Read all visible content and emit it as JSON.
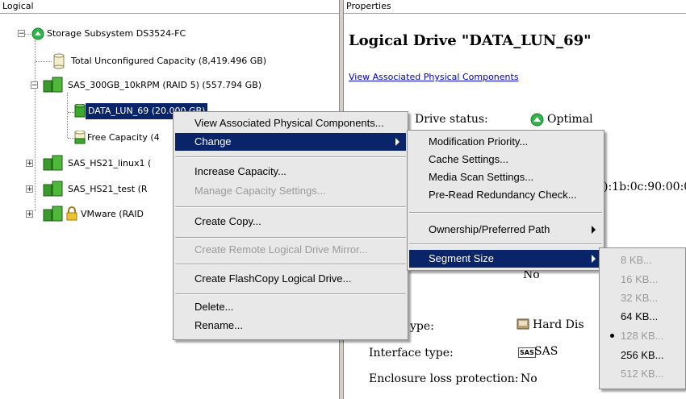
{
  "left_pane": {
    "header": "Logical",
    "tree": {
      "root": "Storage Subsystem DS3524-FC",
      "unconfigured": "Total Unconfigured Capacity (8,419.496 GB)",
      "array1": "SAS_300GB_10kRPM (RAID 5) (557.794 GB)",
      "lun": "DATA_LUN_69 (20.000 GB)",
      "free": "Free Capacity (4",
      "array2": "SAS_HS21_linux1 (",
      "array3": "SAS_HS21_test (R",
      "array4": "VMware (RAID"
    }
  },
  "right_pane": {
    "header": "Properties",
    "title": "Logical Drive \"DATA_LUN_69\"",
    "link": "View Associated Physical Components",
    "drive_status_label": "Drive status:",
    "drive_status_value": "Optimal",
    "wwid_fragment": "):1b:0c:90:00:0",
    "no_value": "No",
    "type_label_fragment": "ype:",
    "type_value": "Hard Dis",
    "interface_label": "Interface type:",
    "interface_badge": "SAS",
    "interface_value": "SAS",
    "enclosure_label": "Enclosure loss protection:",
    "enclosure_value": "No"
  },
  "context_menu": {
    "items": [
      {
        "label": "View Associated Physical Components...",
        "disabled": false
      },
      {
        "label": "Change",
        "disabled": false,
        "submenu": true
      },
      {
        "label": "Increase Capacity...",
        "disabled": false
      },
      {
        "label": "Manage Capacity Settings...",
        "disabled": true
      },
      {
        "label": "Create Copy...",
        "disabled": false
      },
      {
        "label": "Create Remote Logical Drive Mirror...",
        "disabled": true
      },
      {
        "label": "Create FlashCopy Logical Drive...",
        "disabled": false
      },
      {
        "label": "Delete...",
        "disabled": false
      },
      {
        "label": "Rename...",
        "disabled": false
      }
    ]
  },
  "change_submenu": {
    "items": [
      {
        "label": "Modification Priority..."
      },
      {
        "label": "Cache Settings..."
      },
      {
        "label": "Media Scan Settings..."
      },
      {
        "label": "Pre-Read Redundancy Check..."
      },
      {
        "label": "Ownership/Preferred Path",
        "submenu": true
      },
      {
        "label": "Segment Size",
        "submenu": true
      }
    ]
  },
  "segment_submenu": {
    "items": [
      {
        "label": "8 KB...",
        "disabled": true
      },
      {
        "label": "16 KB...",
        "disabled": true
      },
      {
        "label": "32 KB...",
        "disabled": true
      },
      {
        "label": "64 KB...",
        "disabled": false
      },
      {
        "label": "128 KB...",
        "disabled": true,
        "selected": true
      },
      {
        "label": "256 KB...",
        "disabled": false
      },
      {
        "label": "512 KB...",
        "disabled": true
      }
    ]
  },
  "colors": {
    "selection": "#0a246a",
    "status_green": "#2fb54a",
    "drive_green": "#3a9a2a",
    "menu_bg": "#e8e8e8",
    "disabled_text": "#9a9a9a"
  }
}
